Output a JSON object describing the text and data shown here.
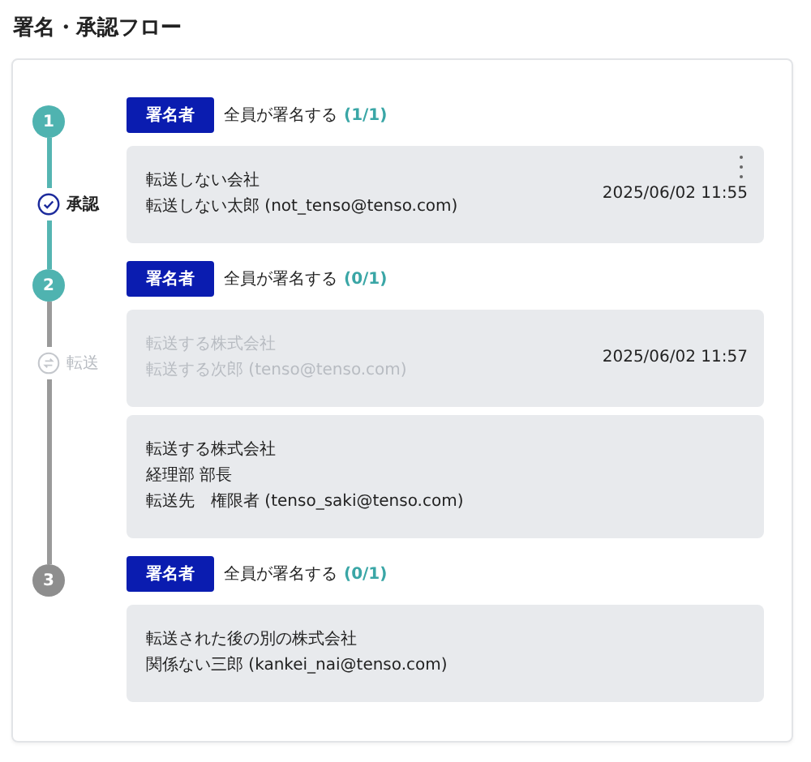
{
  "title": "署名・承認フロー",
  "steps": [
    {
      "number": "1",
      "reached": true,
      "completed": true,
      "role": "署名者",
      "rule": "全員が署名する",
      "count": "(1/1)",
      "entries": [
        {
          "marker": {
            "kind": "approved",
            "label": "承認"
          },
          "disabled": false,
          "menu": true,
          "lines": [
            "転送しない会社",
            "転送しない太郎 (not_tenso@tenso.com)"
          ],
          "timestamp": "2025/06/02 11:55"
        }
      ]
    },
    {
      "number": "2",
      "reached": true,
      "completed": false,
      "role": "署名者",
      "rule": "全員が署名する",
      "count": "(0/1)",
      "entries": [
        {
          "marker": {
            "kind": "forwarded",
            "label": "転送"
          },
          "disabled": true,
          "menu": false,
          "lines": [
            "転送する株式会社",
            "転送する次郎 (tenso@tenso.com)"
          ],
          "timestamp": "2025/06/02 11:57"
        },
        {
          "disabled": false,
          "menu": false,
          "lines": [
            "転送する株式会社",
            "経理部 部長",
            "転送先　権限者 (tenso_saki@tenso.com)"
          ]
        }
      ]
    },
    {
      "number": "3",
      "reached": false,
      "role": "署名者",
      "rule": "全員が署名する",
      "count": "(0/1)",
      "entries": [
        {
          "disabled": false,
          "menu": false,
          "lines": [
            "転送された後の別の株式会社",
            "関係ない三郎 (kankei_nai@tenso.com)"
          ]
        }
      ]
    }
  ]
}
